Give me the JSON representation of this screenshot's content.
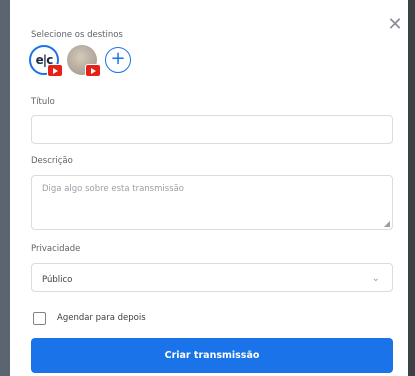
{
  "destinations": {
    "label": "Selecione os destinos",
    "items": [
      {
        "icon": "channel-logo-icon",
        "logo_text": "e|c",
        "badge": "youtube-icon",
        "selected": true
      },
      {
        "icon": "avatar-photo-icon",
        "badge": "youtube-icon",
        "selected": false
      }
    ],
    "add_label": "+"
  },
  "close_label": "✕",
  "title_field": {
    "label": "Título",
    "value": ""
  },
  "description_field": {
    "label": "Descrição",
    "placeholder": "Diga algo sobre esta transmissão"
  },
  "privacy": {
    "label": "Privacidade",
    "selected": "Público",
    "chevron": "⌄"
  },
  "schedule": {
    "label": "Agendar para depois",
    "checked": false
  },
  "submit_label": "Criar transmissão",
  "colors": {
    "accent": "#1a73e8",
    "youtube": "#e62117",
    "border": "#dadce0",
    "backdrop": "#8a8f98"
  }
}
